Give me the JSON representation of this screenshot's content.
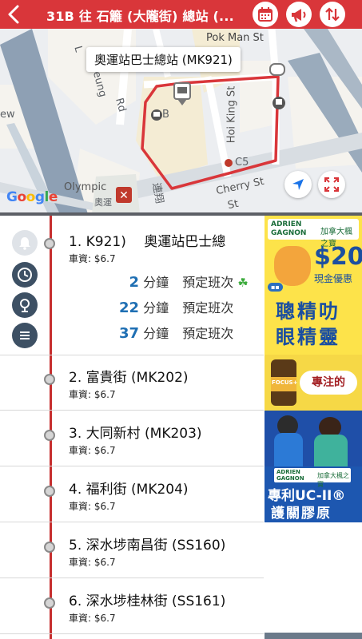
{
  "header": {
    "title": "31B 往 石籬 (大隴街) 總站 (...",
    "colors": {
      "bar": "#d9363a"
    }
  },
  "map": {
    "callout": "奧運站巴士總站 (MK921)",
    "labels": {
      "pok_man": "Pok Man St",
      "hoi_king": "Hoi King St",
      "cherry": "Cherry St",
      "ew": "ew",
      "rd": "Rd",
      "eung": "eung",
      "olympic": "Olympic",
      "olympic_zh": "奧運",
      "c5": "C5",
      "b": "B",
      "st": "St",
      "lian": "連翔",
      "l": "L",
      "google": "Google"
    }
  },
  "side_buttons": [
    "bell-icon",
    "clock-icon",
    "location-pin-icon",
    "menu-icon"
  ],
  "stops": [
    {
      "name": "1. K921)　 奧運站巴士總",
      "fare": "車資: $6.7"
    },
    {
      "name": "2. 富貴街 (MK202)",
      "fare": "車資: $6.7"
    },
    {
      "name": "3. 大同新村 (MK203)",
      "fare": "車資: $6.7"
    },
    {
      "name": "4. 福利街 (MK204)",
      "fare": "車資: $6.7"
    },
    {
      "name": "5. 深水埗南昌街 (SS160)",
      "fare": "車資: $6.7"
    },
    {
      "name": "6. 深水埗桂林街 (SS161)",
      "fare": "車資: $6.7"
    }
  ],
  "etas": [
    {
      "min": "2",
      "unit": "分鐘",
      "status": "預定班次",
      "icon": "clover-icon"
    },
    {
      "min": "22",
      "unit": "分鐘",
      "status": "預定班次"
    },
    {
      "min": "37",
      "unit": "分鐘",
      "status": "預定班次"
    }
  ],
  "ads": {
    "ad1": {
      "brand_en": "ADRIEN GAGNON",
      "brand_zh": "加拿大楓之寶",
      "price": "$20",
      "price_sub": "現金優惠",
      "line1": "聰精叻",
      "line2": "眼精靈"
    },
    "ad2": {
      "bottle": "FOCUS+",
      "cta": "專注的"
    },
    "ad4": {
      "brand_en": "ADRIEN GAGNON",
      "brand_zh": "加拿大楓之寶",
      "line1": "專利UC-II®",
      "line2": "護關膠原"
    }
  }
}
